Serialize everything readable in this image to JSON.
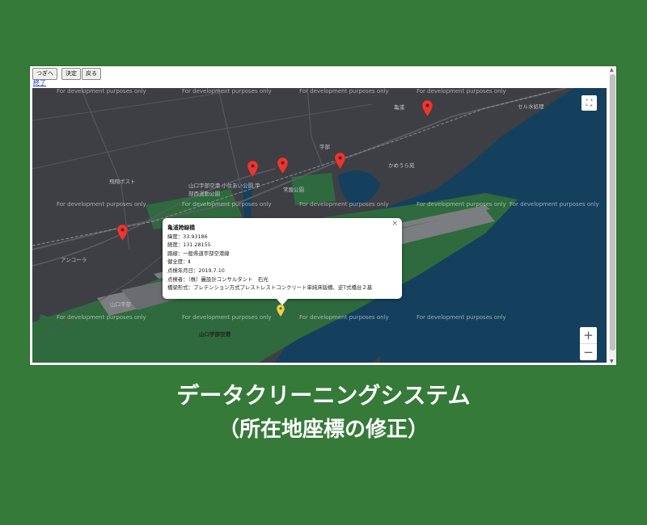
{
  "toolbar": {
    "next_label": "つぎへ",
    "decide_label": "決定",
    "back_label": "戻る",
    "end_link": "終了"
  },
  "map": {
    "watermark": "For development purposes only",
    "labels": {
      "airport": "山口宇部空港",
      "park": "常盤公園",
      "school": "山口宇部空港 小住あい公園 宇部西運動公園",
      "ube_station": "宇部",
      "kamura": "かめうら苑",
      "sekiwa": "セル水処理",
      "ancora": "アンコーラ",
      "yamaguchi_ube": "山口宇部",
      "kyokai": "飛翔ポスト",
      "hashi": "亀浦"
    },
    "controls": {
      "fullscreen_icon": "⛶",
      "zoom_in": "+",
      "zoom_out": "−"
    },
    "colors": {
      "land": "#3d3f44",
      "water": "#14405e",
      "green": "#2e6a3d",
      "road": "#5a5c61"
    }
  },
  "info_window": {
    "title": "亀浦跨線橋",
    "latitude": "緯度：33.93186",
    "longitude": "経度：131.28155",
    "route": "路線：一般県道宇部空港線",
    "health": "健全度：Ⅱ",
    "inspected": "点検年月日：2019.7.10",
    "inspector": "点検者：（株）麗設計コンサルタント　石光",
    "form": "橋梁形式：プレテンション方式プレストレストコンクリート単純床版橋、逆T式橋台２基",
    "close": "×"
  },
  "headline": {
    "line1": "データクリーニングシステム",
    "line2": "（所在地座標の修正）"
  }
}
